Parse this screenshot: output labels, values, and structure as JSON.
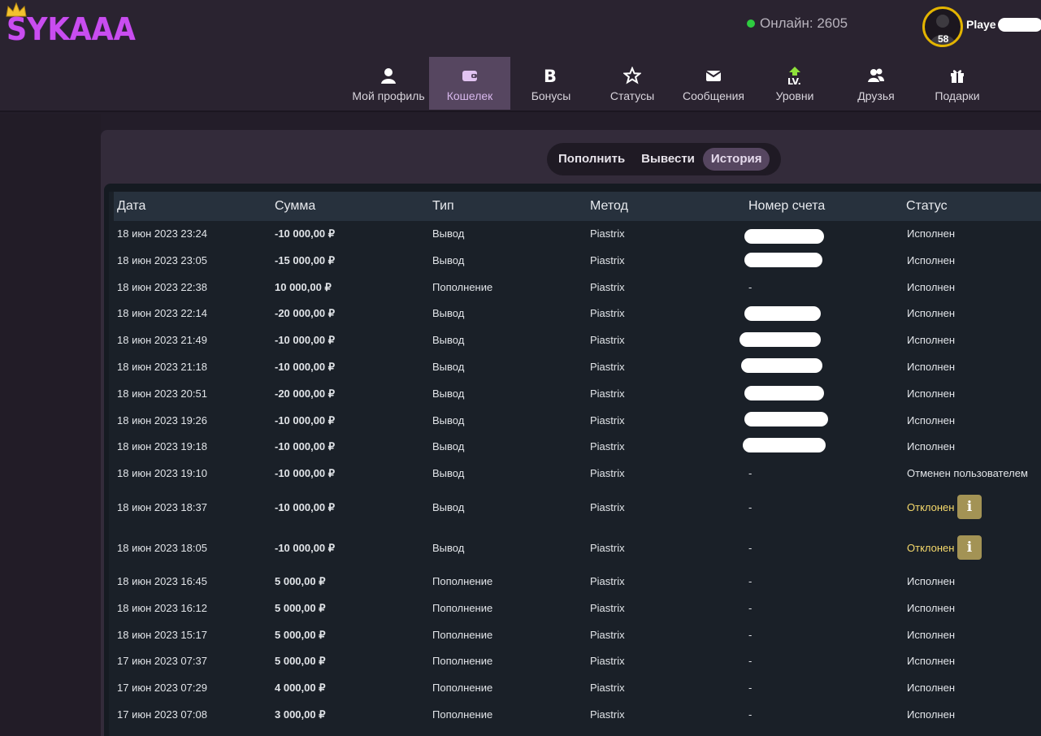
{
  "header": {
    "logo_text": "SYKAAA",
    "online_label": "Онлайн: 2605",
    "player_name": "Playe",
    "avatar_level": "58"
  },
  "nav": [
    {
      "label": "Мой профиль",
      "icon": "user-icon"
    },
    {
      "label": "Кошелек",
      "icon": "wallet-icon",
      "active": true
    },
    {
      "label": "Бонусы",
      "icon": "bonus-b-icon"
    },
    {
      "label": "Статусы",
      "icon": "star-icon"
    },
    {
      "label": "Сообщения",
      "icon": "envelope-icon"
    },
    {
      "label": "Уровни",
      "icon": "level-up-icon"
    },
    {
      "label": "Друзья",
      "icon": "friends-icon"
    },
    {
      "label": "Подарки",
      "icon": "gift-icon"
    }
  ],
  "tabs": [
    {
      "label": "Пополнить"
    },
    {
      "label": "Вывести"
    },
    {
      "label": "История",
      "active": true
    }
  ],
  "table": {
    "columns": [
      "Дата",
      "Сумма",
      "Тип",
      "Метод",
      "Номер счета",
      "Статус"
    ],
    "rows": [
      {
        "date": "18 июн 2023 23:24",
        "amount": "-10 000,00 ₽",
        "type": "Вывод",
        "method": "Piastrix",
        "account": "",
        "status": "Исполнен"
      },
      {
        "date": "18 июн 2023 23:05",
        "amount": "-15 000,00 ₽",
        "type": "Вывод",
        "method": "Piastrix",
        "account": "",
        "status": "Исполнен"
      },
      {
        "date": "18 июн 2023 22:38",
        "amount": "10 000,00 ₽",
        "type": "Пополнение",
        "method": "Piastrix",
        "account": "-",
        "status": "Исполнен"
      },
      {
        "date": "18 июн 2023 22:14",
        "amount": "-20 000,00 ₽",
        "type": "Вывод",
        "method": "Piastrix",
        "account": "",
        "status": "Исполнен"
      },
      {
        "date": "18 июн 2023 21:49",
        "amount": "-10 000,00 ₽",
        "type": "Вывод",
        "method": "Piastrix",
        "account": "",
        "status": "Исполнен"
      },
      {
        "date": "18 июн 2023 21:18",
        "amount": "-10 000,00 ₽",
        "type": "Вывод",
        "method": "Piastrix",
        "account": "",
        "status": "Исполнен"
      },
      {
        "date": "18 июн 2023 20:51",
        "amount": "-20 000,00 ₽",
        "type": "Вывод",
        "method": "Piastrix",
        "account": "",
        "status": "Исполнен"
      },
      {
        "date": "18 июн 2023 19:26",
        "amount": "-10 000,00 ₽",
        "type": "Вывод",
        "method": "Piastrix",
        "account": "",
        "status": "Исполнен"
      },
      {
        "date": "18 июн 2023 19:18",
        "amount": "-10 000,00 ₽",
        "type": "Вывод",
        "method": "Piastrix",
        "account": "",
        "status": "Исполнен"
      },
      {
        "date": "18 июн 2023 19:10",
        "amount": "-10 000,00 ₽",
        "type": "Вывод",
        "method": "Piastrix",
        "account": "-",
        "status": "Отменен пользователем"
      },
      {
        "date": "18 июн 2023 18:37",
        "amount": "-10 000,00 ₽",
        "type": "Вывод",
        "method": "Piastrix",
        "account": "-",
        "status": "Отклонен",
        "info": "i"
      },
      {
        "date": "18 июн 2023 18:05",
        "amount": "-10 000,00 ₽",
        "type": "Вывод",
        "method": "Piastrix",
        "account": "-",
        "status": "Отклонен",
        "info": "i"
      },
      {
        "date": "18 июн 2023 16:45",
        "amount": "5 000,00 ₽",
        "type": "Пополнение",
        "method": "Piastrix",
        "account": "-",
        "status": "Исполнен"
      },
      {
        "date": "18 июн 2023 16:12",
        "amount": "5 000,00 ₽",
        "type": "Пополнение",
        "method": "Piastrix",
        "account": "-",
        "status": "Исполнен"
      },
      {
        "date": "18 июн 2023 15:17",
        "amount": "5 000,00 ₽",
        "type": "Пополнение",
        "method": "Piastrix",
        "account": "-",
        "status": "Исполнен"
      },
      {
        "date": "17 июн 2023 07:37",
        "amount": "5 000,00 ₽",
        "type": "Пополнение",
        "method": "Piastrix",
        "account": "-",
        "status": "Исполнен"
      },
      {
        "date": "17 июн 2023 07:29",
        "amount": "4 000,00 ₽",
        "type": "Пополнение",
        "method": "Piastrix",
        "account": "-",
        "status": "Исполнен"
      },
      {
        "date": "17 июн 2023 07:08",
        "amount": "3 000,00 ₽",
        "type": "Пополнение",
        "method": "Piastrix",
        "account": "-",
        "status": "Исполнен"
      }
    ]
  },
  "colors": {
    "logo": "#c94df0",
    "active_nav": "#564660",
    "rejected_status": "#f5d96b",
    "online_dot": "#2ecc40",
    "avatar_ring": "#e3b400"
  }
}
